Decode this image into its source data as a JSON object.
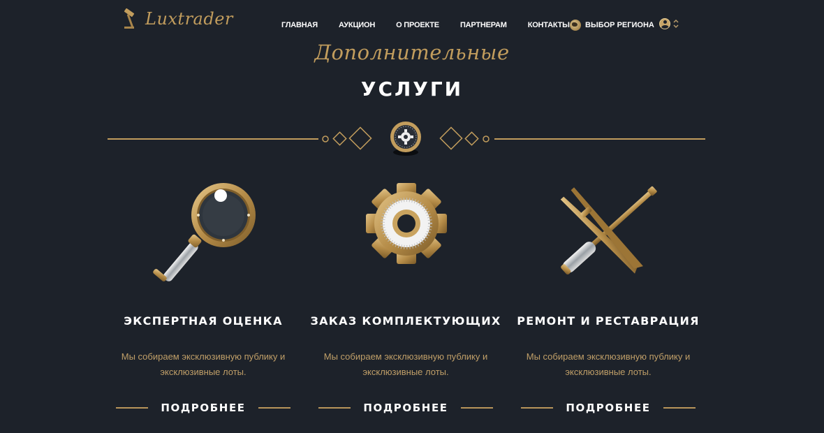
{
  "brand": {
    "name": "Luxtrader",
    "icon": "gavel-icon"
  },
  "nav": {
    "items": [
      {
        "label": "ГЛАВНАЯ"
      },
      {
        "label": "АУКЦИОН"
      },
      {
        "label": "О ПРОЕКТЕ"
      },
      {
        "label": "ПАРТНЕРАМ"
      },
      {
        "label": "КОНТАКТЫ"
      }
    ],
    "region_label": "ВЫБОР РЕГИОНА",
    "region_icon": "globe-icon",
    "user_icon": "user-icon",
    "user_menu_icon": "chevron-updown-icon"
  },
  "section": {
    "subtitle": "Дополнительные",
    "title": "УСЛУГИ",
    "emblem_icon": "gear-medallion-icon"
  },
  "services": [
    {
      "title": "ЭКСПЕРТНАЯ ОЦЕНКА",
      "description": "Мы собираем эксклюзивную публику и эксклюзивные лоты.",
      "more_label": "ПОДРОБНЕЕ",
      "icon": "magnifying-glass-icon"
    },
    {
      "title": "ЗАКАЗ КОМПЛЕКТУЮЩИХ",
      "description": "Мы собираем эксклюзивную публику и эксклюзивные лоты.",
      "more_label": "ПОДРОБНЕЕ",
      "icon": "gear-icon"
    },
    {
      "title": "РЕМОНТ И РЕСТАВРАЦИЯ",
      "description": "Мы собираем эксклюзивную публику и эксклюзивные лоты.",
      "more_label": "ПОДРОБНЕЕ",
      "icon": "tweezers-screwdriver-icon"
    }
  ],
  "colors": {
    "background": "#1d222a",
    "gold": "#c29d5d",
    "gold_text": "#c09f68",
    "text": "#ffffff"
  }
}
